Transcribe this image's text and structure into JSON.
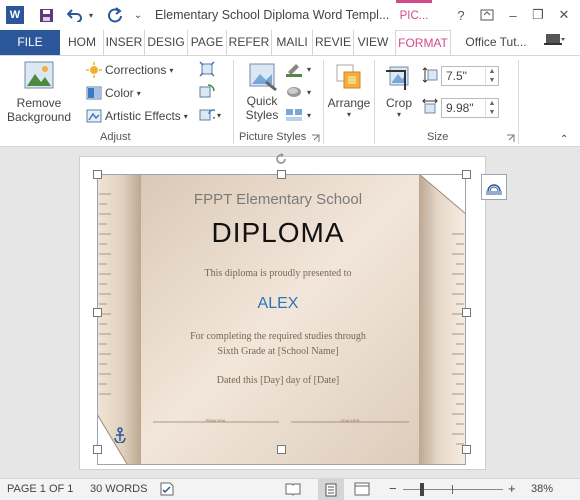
{
  "window": {
    "title": "Elementary School Diploma Word Templ...",
    "contextual_tab_header": "PIC..."
  },
  "quick_access": {
    "save_icon": "save-icon",
    "undo_icon": "undo-icon",
    "redo_icon": "redo-icon"
  },
  "window_controls": {
    "help": "?",
    "minimize": "–",
    "restore": "❐",
    "close": "✕"
  },
  "tabs": {
    "file": "FILE",
    "items": [
      "HOM",
      "INSER",
      "DESIG",
      "PAGE",
      "REFER",
      "MAILI",
      "REVIE",
      "VIEW"
    ],
    "active": "FORMAT",
    "account": "Office Tut..."
  },
  "ribbon": {
    "adjust": {
      "remove_background": [
        "Remove",
        "Background"
      ],
      "corrections": "Corrections",
      "color": "Color",
      "artistic_effects": "Artistic Effects",
      "label": "Adjust"
    },
    "picture_styles": {
      "quick_styles": [
        "Quick",
        "Styles"
      ],
      "label": "Picture Styles"
    },
    "arrange": {
      "label": "Arrange"
    },
    "size": {
      "crop": "Crop",
      "height": "7.5\"",
      "width": "9.98\"",
      "label": "Size"
    }
  },
  "document": {
    "school": "FPPT Elementary School",
    "heading": "DIPLOMA",
    "presented": "This diploma is proudly presented to",
    "name": "ALEX",
    "completing_1": "For completing the required studies through",
    "completing_2": "Sixth Grade at [School Name]",
    "dated": "Dated this [Day] day of [Date]",
    "sig_left": "PRINCIPAL",
    "sig_right": "TEACHER"
  },
  "status": {
    "page": "PAGE 1 OF 1",
    "words": "30 WORDS",
    "zoom": "38%",
    "zoom_minus": "−",
    "zoom_plus": "+"
  },
  "colors": {
    "word_blue": "#2b579a",
    "format_pink": "#d34a8c",
    "scroll_paper": "#e8d9c8",
    "name_blue": "#2e74b5"
  }
}
